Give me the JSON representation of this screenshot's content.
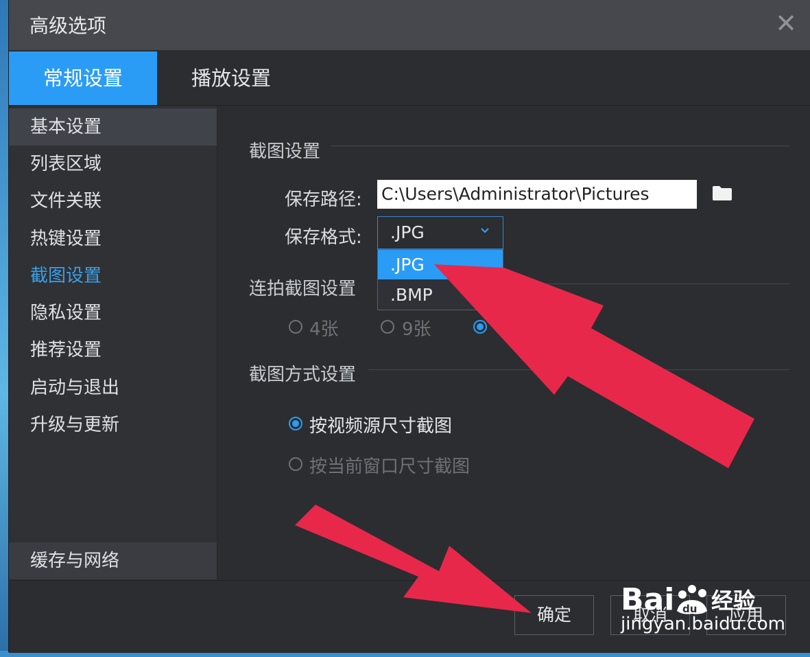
{
  "dialog": {
    "title": "高级选项"
  },
  "tabs": [
    {
      "label": "常规设置"
    },
    {
      "label": "播放设置"
    }
  ],
  "sidebar": {
    "items": [
      {
        "label": "基本设置"
      },
      {
        "label": "列表区域"
      },
      {
        "label": "文件关联"
      },
      {
        "label": "热键设置"
      },
      {
        "label": "截图设置"
      },
      {
        "label": "隐私设置"
      },
      {
        "label": "推荐设置"
      },
      {
        "label": "启动与退出"
      },
      {
        "label": "升级与更新"
      }
    ],
    "bottom_item": "缓存与网络"
  },
  "screenshot_settings": {
    "section_title": "截图设置",
    "save_path_label": "保存路径:",
    "save_path_value": "C:\\Users\\Administrator\\Pictures",
    "save_format_label": "保存格式:",
    "save_format_value": ".JPG",
    "format_options": [
      ".JPG",
      ".BMP"
    ]
  },
  "burst_settings": {
    "section_title": "连拍截图设置",
    "options": [
      {
        "label": "4张"
      },
      {
        "label": "9张"
      }
    ]
  },
  "capture_mode": {
    "section_title": "截图方式设置",
    "options": [
      {
        "label": "按视频源尺寸截图",
        "selected": true
      },
      {
        "label": "按当前窗口尺寸截图",
        "selected": false
      }
    ]
  },
  "footer": {
    "ok": "确定",
    "cancel": "取消",
    "apply": "应用"
  },
  "watermark": {
    "brand_left": "Bai",
    "brand_paw": "du",
    "brand_right": "经验",
    "url": "jingyan.baidu.com"
  },
  "colors": {
    "accent": "#2a9cf6",
    "arrow": "#e8284a",
    "panel": "#2b2d31"
  }
}
